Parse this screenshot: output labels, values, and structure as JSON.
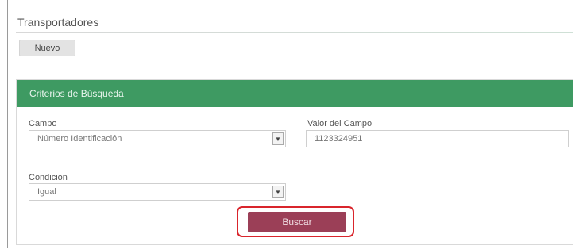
{
  "page": {
    "title": "Transportadores",
    "new_button": "Nuevo"
  },
  "panel": {
    "header": "Criterios de Búsqueda",
    "campo": {
      "label": "Campo",
      "selected": "Número Identificación"
    },
    "valor": {
      "label": "Valor del Campo",
      "value": "1123324951"
    },
    "condicion": {
      "label": "Condición",
      "selected": "Igual"
    },
    "search_button": "Buscar"
  },
  "colors": {
    "header_green": "#3e9a62",
    "button_maroon": "#9b3f57",
    "highlight_red": "#d9252c"
  },
  "icons": {
    "select_arrow": "chevron-down-icon"
  }
}
